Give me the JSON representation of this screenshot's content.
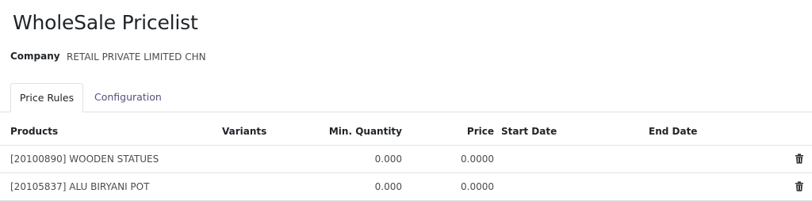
{
  "page": {
    "title": "WholeSale Pricelist"
  },
  "company": {
    "label": "Company",
    "value": "RETAIL PRIVATE LIMITED CHN"
  },
  "tabs": [
    {
      "label": "Price Rules",
      "active": true
    },
    {
      "label": "Configuration",
      "active": false
    }
  ],
  "table": {
    "columns": {
      "products": "Products",
      "variants": "Variants",
      "min_quantity": "Min. Quantity",
      "price": "Price",
      "start_date": "Start Date",
      "end_date": "End Date"
    },
    "rows": [
      {
        "product": "[20100890] WOODEN STATUES",
        "variants": "",
        "min_quantity": "0.000",
        "price": "0.0000",
        "start_date": "",
        "end_date": ""
      },
      {
        "product": "[20105837] ALU BIRYANI POT",
        "variants": "",
        "min_quantity": "0.000",
        "price": "0.0000",
        "start_date": "",
        "end_date": ""
      }
    ]
  },
  "icons": {
    "delete": "trash-icon"
  }
}
